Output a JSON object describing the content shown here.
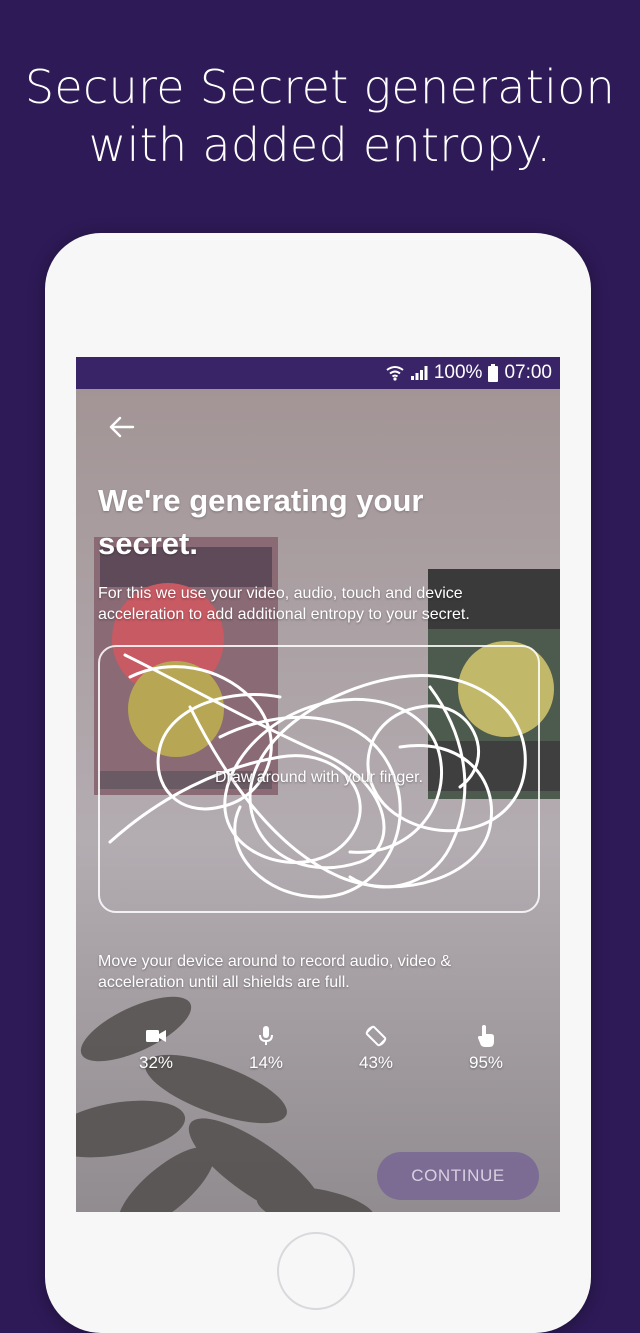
{
  "headline": {
    "line1": "Secure Secret generation",
    "line2": "with added entropy."
  },
  "status_bar": {
    "battery_text": "100%",
    "time": "07:00",
    "icons": [
      "wifi-icon",
      "signal-icon",
      "battery-icon"
    ]
  },
  "screen": {
    "title": "We're generating your secret.",
    "description": "For this we use your video, audio, touch and device acceleration to add additional entropy to your secret.",
    "draw_hint": "Draw around with your finger.",
    "move_instruction": "Move your device around to record audio, video & acceleration until all shields are full.",
    "meters": [
      {
        "icon": "video-camera-icon",
        "value": "32%"
      },
      {
        "icon": "microphone-icon",
        "value": "14%"
      },
      {
        "icon": "screen-rotation-icon",
        "value": "43%"
      },
      {
        "icon": "touch-finger-icon",
        "value": "95%"
      }
    ],
    "continue_label": "CONTINUE"
  },
  "colors": {
    "background": "#2e1a57",
    "status_bar": "#3a2468",
    "button": "#786694"
  }
}
